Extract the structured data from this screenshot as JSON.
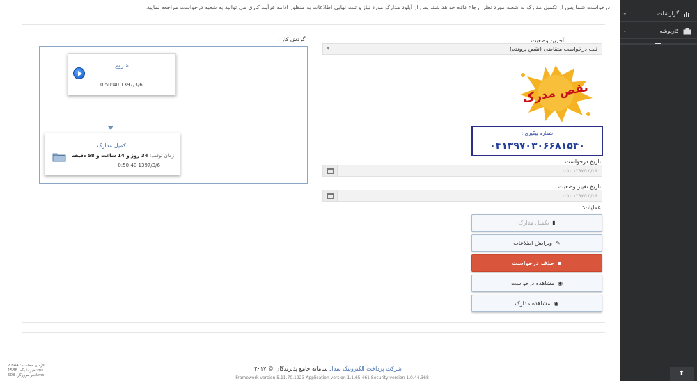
{
  "top_message": "درخواست شما پس از تکمیل مدارک به شعبه مورد نظر ارجاع داده خواهد شد. پس از آپلود مدارک مورد نیاز و ثبت نهایی اطلاعات به منظور ادامه فرآیند کاری می توانید به شعبه درخواست مراجعه نمایید.",
  "workflow": {
    "title": "گردش کار :",
    "start_node": {
      "title": "شروع",
      "date": "0:50:40 1397/3/6"
    },
    "docs_node": {
      "title": "تکمیل مدارک",
      "duration_label": "زمان توقف:",
      "duration_value": "34 روز و 14 ساعت و 58 دقیقه",
      "date": "0:50:40 1397/3/6"
    }
  },
  "form": {
    "status_label": "آخرین وضعیت :",
    "status_value": "ثبت درخواست متقاضی (نقص پرونده)",
    "stamp_text": "نقص مدرک",
    "tracking_label": "شماره پیگیری :",
    "tracking_number": "۰۴۱۳۹۷۰۳۰۶۶۸۱۵۴۰",
    "request_date_label": "تاریخ درخواست :",
    "request_date_value": "۰۰:۵۰ ۱۳۹۷/۰۳/۰۶",
    "status_change_label": "تاریخ تغییر وضعیت :",
    "status_change_value": "۰۰:۵۰ ۱۳۹۷/۰۳/۰۶",
    "operations_label": "عملیات:"
  },
  "buttons": [
    {
      "label": "تکمیل مدارک",
      "icon": "book-icon"
    },
    {
      "label": "ویرایش اطلاعات",
      "icon": "edit-icon"
    },
    {
      "label": "حذف درخواست",
      "icon": "trash-icon"
    },
    {
      "label": "مشاهده درخواست",
      "icon": "eye-icon"
    },
    {
      "label": "مشاهده مدارک",
      "icon": "eye-icon"
    }
  ],
  "footer": {
    "company": "شرکت پرداخت الکترونیک سداد",
    "system": "سامانه جامع پذیرندگان © ۲۰۱۷",
    "version": "Framework version 5.11.70.1923 Application version 1.1.65.461 Security version 1.0.44.368",
    "stats": [
      "زمان محاسبه: 2.844s",
      "تاخیر شبکه: 1588ms",
      "تاخیر مرورگر: 503ms"
    ]
  },
  "sidebar": {
    "items": [
      {
        "label": "گزارشات",
        "icon": "chart-icon"
      },
      {
        "label": "کارپوشه",
        "icon": "briefcase-icon"
      }
    ]
  },
  "colors": {
    "accent": "#3d6aa8",
    "danger": "#d9553c",
    "tracking": "#2b2f86",
    "sidebar": "#2b2d2f"
  }
}
